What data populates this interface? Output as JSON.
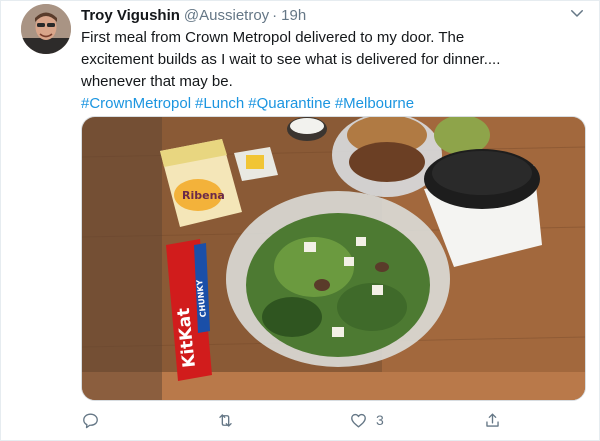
{
  "tweet": {
    "display_name": "Troy Vigushin",
    "handle": "@Aussietroy",
    "separator": "·",
    "time": "19h",
    "text_lines": [
      "First meal from Crown Metropol delivered to my door. The",
      "excitement builds as I wait to see what is delivered for dinner....",
      "whenever that may be."
    ],
    "hashtags": [
      "#CrownMetropol",
      "#Lunch",
      "#Quarantine",
      "#Melbourne"
    ],
    "photo_text": {
      "chocolate_brand": "KitKat",
      "chocolate_variant": "CHUNKY",
      "juice_brand": "Ribena"
    },
    "actions": {
      "reply_icon": "reply-icon",
      "retweet_icon": "retweet-icon",
      "like_icon": "heart-icon",
      "like_count": "3",
      "share_icon": "share-icon"
    }
  },
  "colors": {
    "link": "#1b95e0",
    "secondary_text": "#657786",
    "primary_text": "#14171a",
    "border": "#e6ecf0"
  }
}
